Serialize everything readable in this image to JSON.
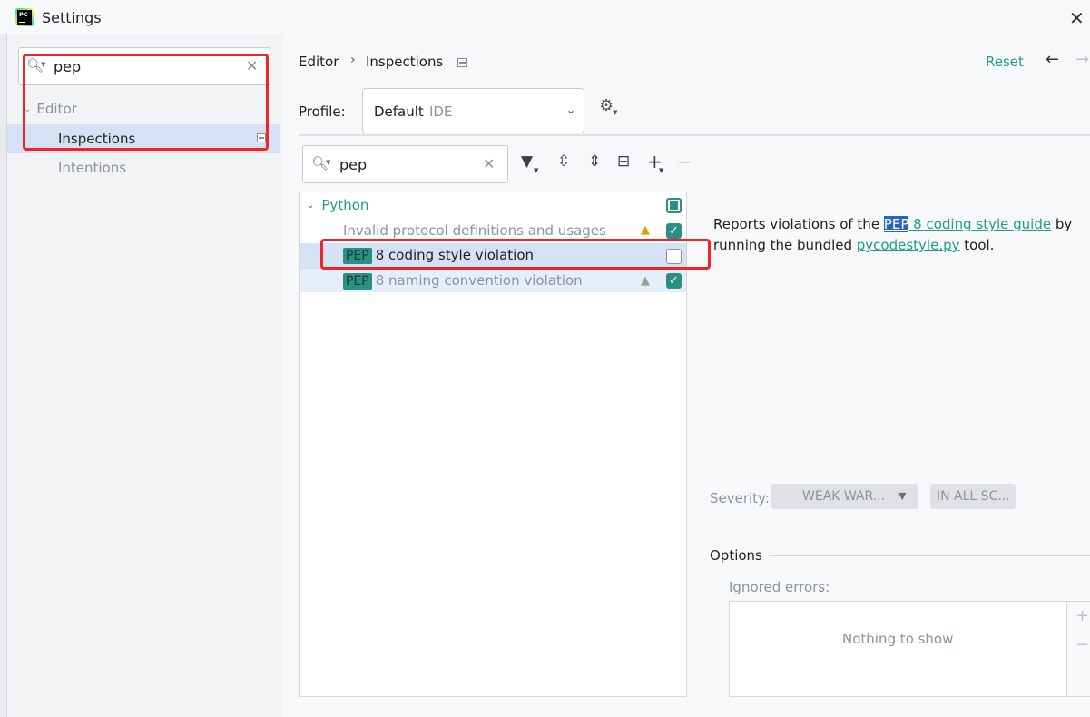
{
  "window": {
    "title": "Settings",
    "app_icon_text": "PC"
  },
  "left": {
    "search": {
      "value": "pep"
    },
    "tree": {
      "editor": "Editor",
      "inspections": "Inspections",
      "intentions": "Intentions"
    }
  },
  "right": {
    "breadcrumb": {
      "editor": "Editor",
      "separator": "›",
      "inspections": "Inspections"
    },
    "reset": "Reset",
    "profile": {
      "label": "Profile:",
      "value": "Default",
      "sub": "IDE"
    },
    "search": {
      "value": "pep"
    },
    "tree": {
      "python": "Python",
      "items": [
        {
          "label": "Invalid protocol definitions and usages",
          "checked": true,
          "warning": "yellow"
        },
        {
          "badge": "PEP",
          "label": "8 coding style violation",
          "checked": false
        },
        {
          "badge": "PEP",
          "label": "8 naming convention violation",
          "checked": true,
          "warning": "grey"
        }
      ]
    },
    "description": {
      "part1": "Reports violations of the ",
      "pep": "PEP",
      "link1": " 8 coding style guide",
      "part2": " by running the bundled ",
      "link2": "pycodestyle.py",
      "part3": " tool."
    },
    "severity": {
      "label": "Severity:",
      "value": "WEAK WAR...",
      "scope": "IN ALL SC..."
    },
    "options": {
      "label": "Options",
      "ignored_label": "Ignored errors:",
      "empty": "Nothing to show"
    }
  },
  "colors": {
    "accent": "#1f9e8c",
    "selection": "#d5e1f5",
    "annotation_red": "#f02525",
    "checkbox": "#2d8f83"
  }
}
